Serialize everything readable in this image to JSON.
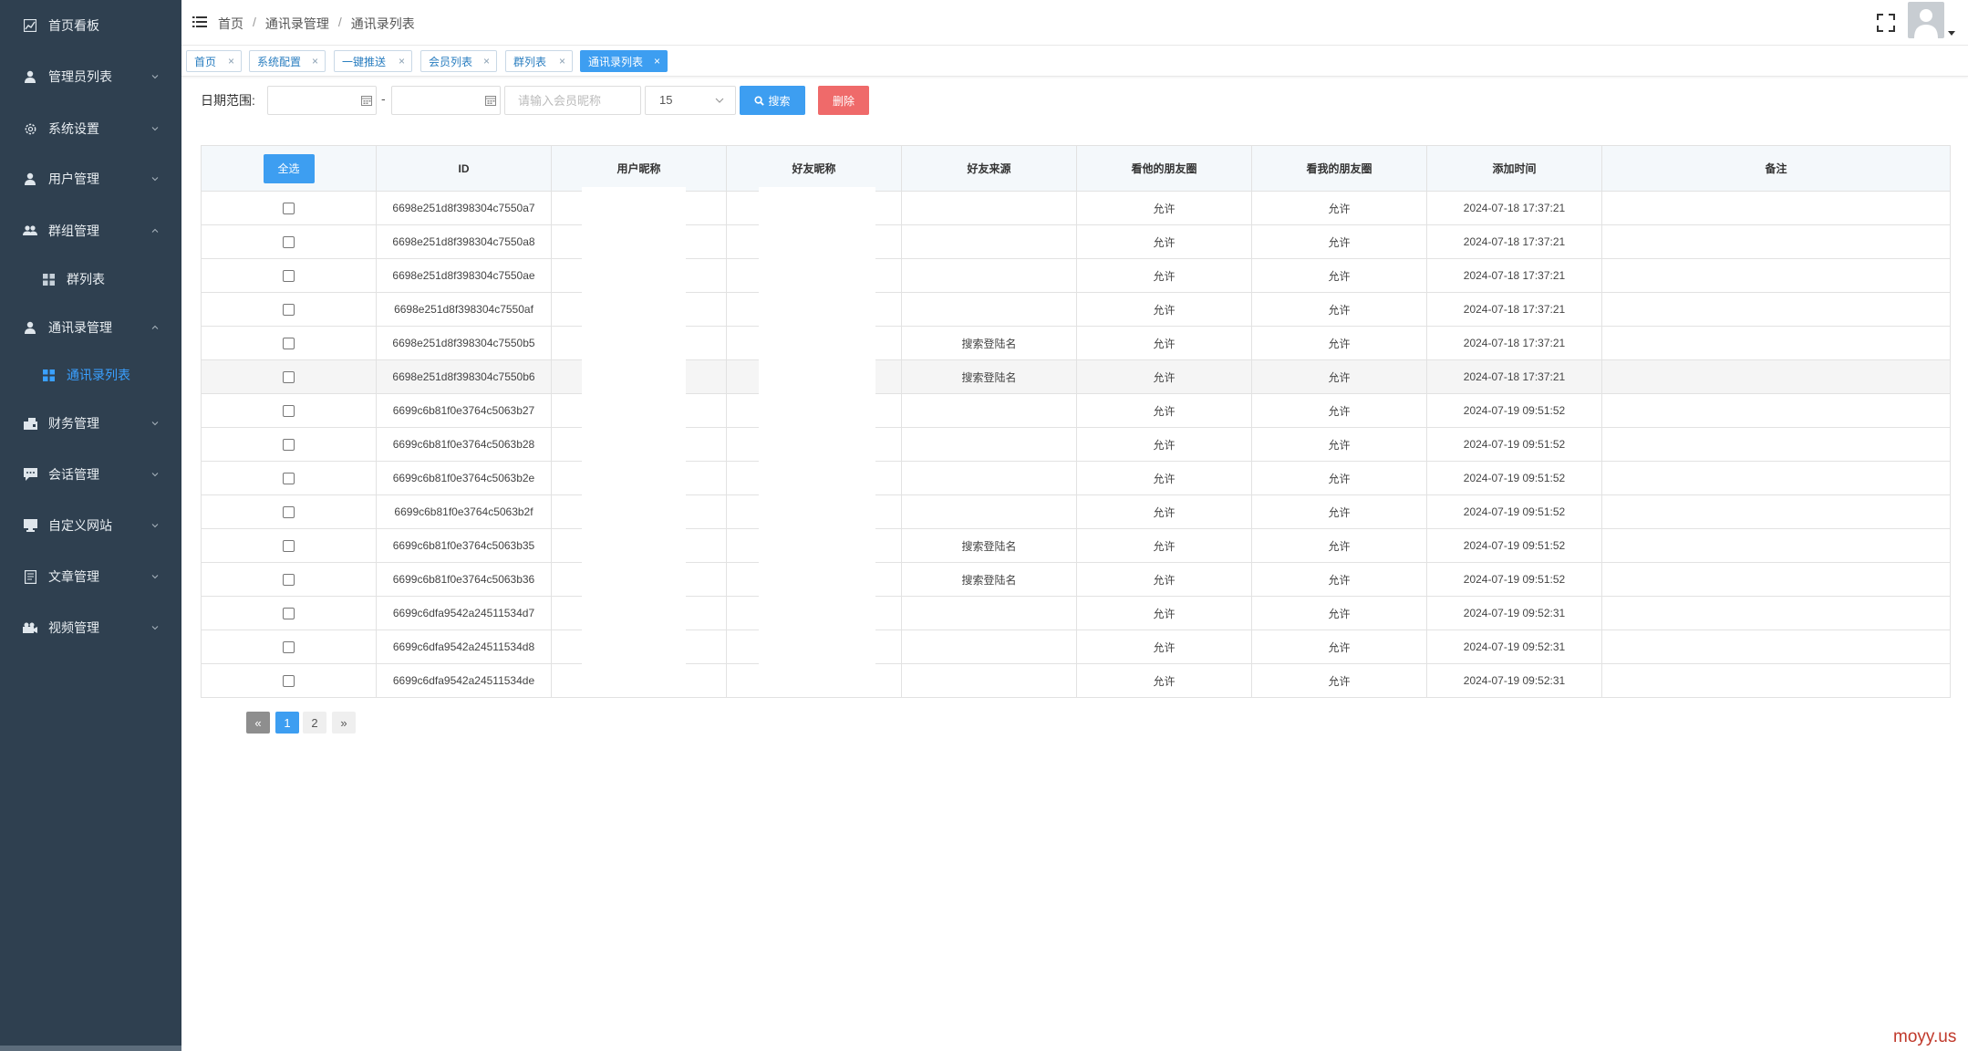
{
  "sidebar": {
    "items": [
      {
        "label": "首页看板",
        "icon": "chart-icon"
      },
      {
        "label": "管理员列表",
        "icon": "user-icon"
      },
      {
        "label": "系统设置",
        "icon": "gear-icon"
      },
      {
        "label": "用户管理",
        "icon": "user-icon"
      },
      {
        "label": "群组管理",
        "icon": "group-icon"
      },
      {
        "label": "群列表",
        "icon": "grid-icon"
      },
      {
        "label": "通讯录管理",
        "icon": "user-icon"
      },
      {
        "label": "通讯录列表",
        "icon": "grid-icon"
      },
      {
        "label": "财务管理",
        "icon": "wallet-icon"
      },
      {
        "label": "会话管理",
        "icon": "chat-icon"
      },
      {
        "label": "自定义网站",
        "icon": "monitor-icon"
      },
      {
        "label": "文章管理",
        "icon": "document-icon"
      },
      {
        "label": "视频管理",
        "icon": "video-icon"
      }
    ]
  },
  "header": {
    "breadcrumb": [
      "首页",
      "通讯录管理",
      "通讯录列表"
    ],
    "separator": "/"
  },
  "tabs": [
    {
      "label": "首页",
      "close": "×"
    },
    {
      "label": "系统配置",
      "close": "×"
    },
    {
      "label": "一键推送",
      "close": "×"
    },
    {
      "label": "会员列表",
      "close": "×"
    },
    {
      "label": "群列表",
      "close": "×"
    },
    {
      "label": "通讯录列表",
      "close": "×"
    }
  ],
  "filter": {
    "date_label": "日期范围:",
    "dash": "-",
    "name_placeholder": "请输入会员昵称",
    "page_size": "15",
    "search_label": "搜索",
    "delete_label": "删除"
  },
  "table": {
    "select_all": "全选",
    "headers": [
      "ID",
      "用户昵称",
      "好友昵称",
      "好友来源",
      "看他的朋友圈",
      "看我的朋友圈",
      "添加时间",
      "备注"
    ],
    "rows": [
      {
        "id": "6698e251d8f398304c7550a7",
        "source": "",
        "see_his": "允许",
        "see_mine": "允许",
        "time": "2024-07-18 17:37:21",
        "note": ""
      },
      {
        "id": "6698e251d8f398304c7550a8",
        "source": "",
        "see_his": "允许",
        "see_mine": "允许",
        "time": "2024-07-18 17:37:21",
        "note": ""
      },
      {
        "id": "6698e251d8f398304c7550ae",
        "source": "",
        "see_his": "允许",
        "see_mine": "允许",
        "time": "2024-07-18 17:37:21",
        "note": ""
      },
      {
        "id": "6698e251d8f398304c7550af",
        "source": "",
        "see_his": "允许",
        "see_mine": "允许",
        "time": "2024-07-18 17:37:21",
        "note": ""
      },
      {
        "id": "6698e251d8f398304c7550b5",
        "source": "搜索登陆名",
        "see_his": "允许",
        "see_mine": "允许",
        "time": "2024-07-18 17:37:21",
        "note": ""
      },
      {
        "id": "6698e251d8f398304c7550b6",
        "source": "搜索登陆名",
        "see_his": "允许",
        "see_mine": "允许",
        "time": "2024-07-18 17:37:21",
        "note": ""
      },
      {
        "id": "6699c6b81f0e3764c5063b27",
        "source": "",
        "see_his": "允许",
        "see_mine": "允许",
        "time": "2024-07-19 09:51:52",
        "note": ""
      },
      {
        "id": "6699c6b81f0e3764c5063b28",
        "source": "",
        "see_his": "允许",
        "see_mine": "允许",
        "time": "2024-07-19 09:51:52",
        "note": ""
      },
      {
        "id": "6699c6b81f0e3764c5063b2e",
        "source": "",
        "see_his": "允许",
        "see_mine": "允许",
        "time": "2024-07-19 09:51:52",
        "note": ""
      },
      {
        "id": "6699c6b81f0e3764c5063b2f",
        "source": "",
        "see_his": "允许",
        "see_mine": "允许",
        "time": "2024-07-19 09:51:52",
        "note": ""
      },
      {
        "id": "6699c6b81f0e3764c5063b35",
        "source": "搜索登陆名",
        "see_his": "允许",
        "see_mine": "允许",
        "time": "2024-07-19 09:51:52",
        "note": ""
      },
      {
        "id": "6699c6b81f0e3764c5063b36",
        "source": "搜索登陆名",
        "see_his": "允许",
        "see_mine": "允许",
        "time": "2024-07-19 09:51:52",
        "note": ""
      },
      {
        "id": "6699c6dfa9542a24511534d7",
        "source": "",
        "see_his": "允许",
        "see_mine": "允许",
        "time": "2024-07-19 09:52:31",
        "note": ""
      },
      {
        "id": "6699c6dfa9542a24511534d8",
        "source": "",
        "see_his": "允许",
        "see_mine": "允许",
        "time": "2024-07-19 09:52:31",
        "note": ""
      },
      {
        "id": "6699c6dfa9542a24511534de",
        "source": "",
        "see_his": "允许",
        "see_mine": "允许",
        "time": "2024-07-19 09:52:31",
        "note": ""
      }
    ]
  },
  "pagination": {
    "prev": "«",
    "pages": [
      "1",
      "2"
    ],
    "current": "1",
    "next": "»"
  },
  "watermark": "moyy.us",
  "colors": {
    "sidebar_bg": "#2f4050",
    "primary": "#3d9ef1",
    "danger": "#ef6a6a",
    "active_nav": "#3aa0ff"
  }
}
